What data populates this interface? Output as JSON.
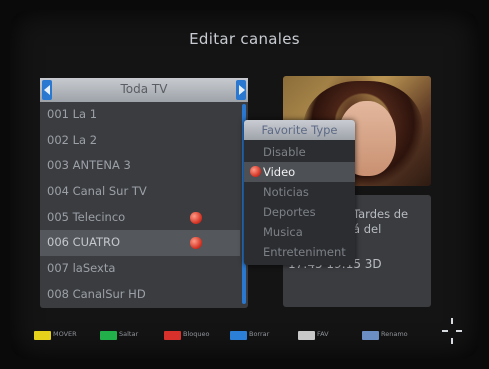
{
  "title": "Editar canales",
  "group": {
    "label": "Toda TV"
  },
  "channels": [
    {
      "label": "001 La 1",
      "fav": false
    },
    {
      "label": "002 La 2",
      "fav": false
    },
    {
      "label": "003 ANTENA 3",
      "fav": false
    },
    {
      "label": "004 Canal Sur TV",
      "fav": false
    },
    {
      "label": "005 Telecinco",
      "fav": true
    },
    {
      "label": "006 CUATRO",
      "fav": true
    },
    {
      "label": "007 laSexta",
      "fav": false
    },
    {
      "label": "008 CanalSur HD",
      "fav": false
    }
  ],
  "selected_channel_index": 5,
  "favorite_menu": {
    "title": "Favorite Type",
    "items": [
      "Disable",
      "Video",
      "Noticias",
      "Deportes",
      "Musica",
      "Entreteniment"
    ],
    "selected_index": 1
  },
  "info": {
    "text_fragment_1": "Tardes de",
    "text_fragment_2": "á del",
    "time": "17:45 19:15  3D"
  },
  "help": [
    {
      "color": "#e6d21b",
      "label": "MOVER"
    },
    {
      "color": "#22b04a",
      "label": "Saltar"
    },
    {
      "color": "#d8302a",
      "label": "Bloqueo"
    },
    {
      "color": "#2c7fd6",
      "label": "Borrar"
    },
    {
      "color": "#c8c8c8",
      "icon": "fav-key-icon",
      "label": "FAV"
    },
    {
      "color": "#6b8fc4",
      "icon": "rename-key-icon",
      "label": "Renamo"
    }
  ],
  "colors": {
    "accent": "#2a78d0",
    "lock_red": "#d43324"
  }
}
